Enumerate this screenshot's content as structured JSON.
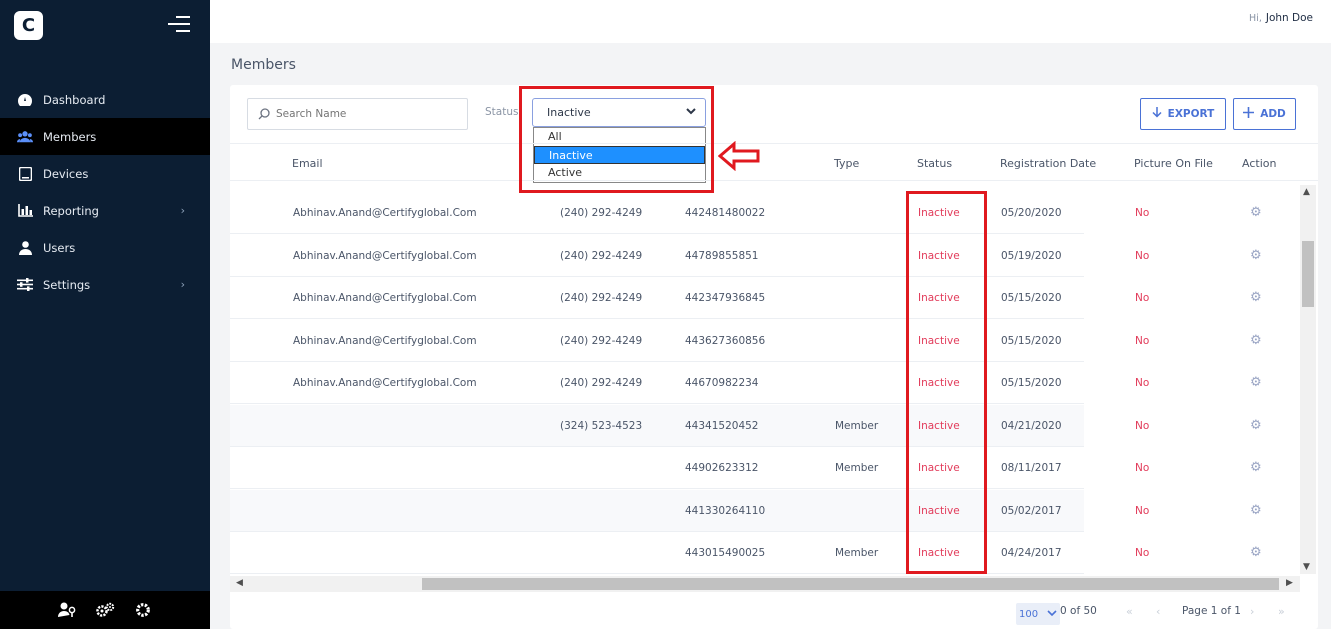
{
  "app": {
    "logo_letter": "C"
  },
  "user": {
    "hi": "Hi,",
    "name": "John Doe"
  },
  "sidebar": {
    "items": [
      {
        "label": "Dashboard",
        "icon": "gauge-icon",
        "active": false,
        "has_chevron": false
      },
      {
        "label": "Members",
        "icon": "users-icon",
        "active": true,
        "has_chevron": false
      },
      {
        "label": "Devices",
        "icon": "tablet-icon",
        "active": false,
        "has_chevron": false
      },
      {
        "label": "Reporting",
        "icon": "bar-chart-icon",
        "active": false,
        "has_chevron": true
      },
      {
        "label": "Users",
        "icon": "user-icon",
        "active": false,
        "has_chevron": false
      },
      {
        "label": "Settings",
        "icon": "sliders-icon",
        "active": false,
        "has_chevron": true
      }
    ]
  },
  "page": {
    "title": "Members"
  },
  "filters": {
    "search_placeholder": "Search Name",
    "status_label": "Status",
    "status_selected": "Inactive",
    "status_options": [
      "All",
      "Inactive",
      "Active"
    ]
  },
  "toolbar": {
    "export_label": "EXPORT",
    "add_label": "ADD"
  },
  "table": {
    "columns": [
      "Email",
      "Type",
      "Status",
      "Registration Date",
      "Picture On File",
      "Action"
    ],
    "rows": [
      {
        "email": "Abhinav.Anand@Certifyglobal.Com",
        "phone": "(240) 292-4249",
        "id": "442481480022",
        "type": "",
        "status": "Inactive",
        "date": "05/20/2020",
        "pic": "No"
      },
      {
        "email": "Abhinav.Anand@Certifyglobal.Com",
        "phone": "(240) 292-4249",
        "id": "44789855851",
        "type": "",
        "status": "Inactive",
        "date": "05/19/2020",
        "pic": "No"
      },
      {
        "email": "Abhinav.Anand@Certifyglobal.Com",
        "phone": "(240) 292-4249",
        "id": "442347936845",
        "type": "",
        "status": "Inactive",
        "date": "05/15/2020",
        "pic": "No"
      },
      {
        "email": "Abhinav.Anand@Certifyglobal.Com",
        "phone": "(240) 292-4249",
        "id": "443627360856",
        "type": "",
        "status": "Inactive",
        "date": "05/15/2020",
        "pic": "No"
      },
      {
        "email": "Abhinav.Anand@Certifyglobal.Com",
        "phone": "(240) 292-4249",
        "id": "44670982234",
        "type": "",
        "status": "Inactive",
        "date": "05/15/2020",
        "pic": "No"
      },
      {
        "email": "",
        "phone": "(324) 523-4523",
        "id": "44341520452",
        "type": "Member",
        "status": "Inactive",
        "date": "04/21/2020",
        "pic": "No"
      },
      {
        "email": "",
        "phone": "",
        "id": "44902623312",
        "type": "Member",
        "status": "Inactive",
        "date": "08/11/2017",
        "pic": "No"
      },
      {
        "email": "",
        "phone": "",
        "id": "441330264110",
        "type": "",
        "status": "Inactive",
        "date": "05/02/2017",
        "pic": "No"
      },
      {
        "email": "",
        "phone": "",
        "id": "443015490025",
        "type": "Member",
        "status": "Inactive",
        "date": "04/24/2017",
        "pic": "No"
      }
    ]
  },
  "pagination": {
    "per_page": "100",
    "range": "0 of 50",
    "page_text": "Page 1 of 1"
  },
  "colors": {
    "sidebar_bg": "#0c1e33",
    "accent": "#4a72d6",
    "status_red": "#e23b5a",
    "highlight_red": "#e0191f",
    "selected_option": "#1e90ff"
  }
}
